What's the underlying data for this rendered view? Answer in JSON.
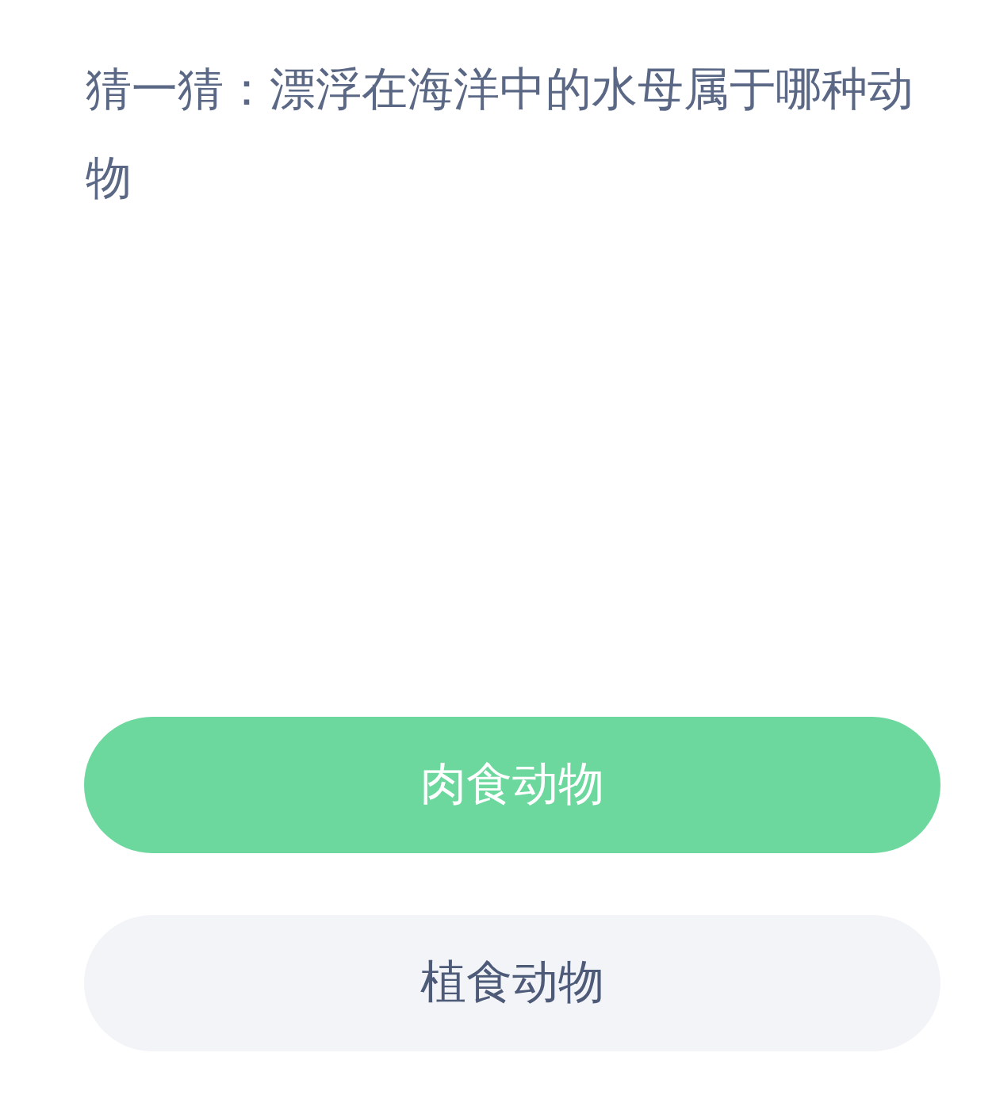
{
  "question": "猜一猜：漂浮在海洋中的水母属于哪种动物",
  "options": [
    {
      "label": "肉食动物",
      "selected": true
    },
    {
      "label": "植食动物",
      "selected": false
    }
  ]
}
